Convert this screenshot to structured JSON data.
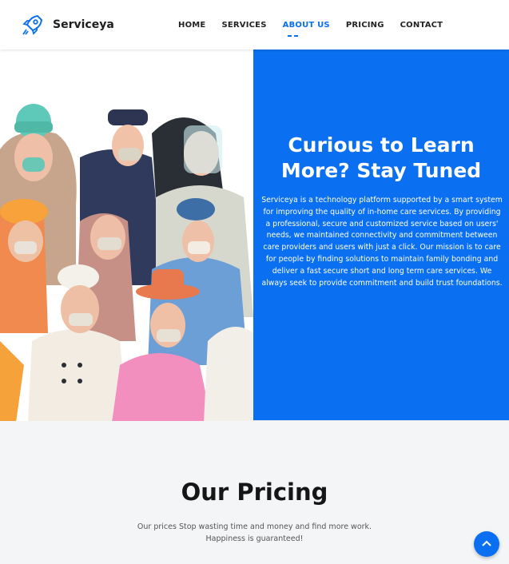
{
  "brand": {
    "name": "Serviceya",
    "logo_icon": "rocket-icon",
    "logo_color": "#0a6ff0"
  },
  "nav": {
    "items": [
      {
        "label": "HOME"
      },
      {
        "label": "SERVICES"
      },
      {
        "label": "ABOUT US",
        "active": true
      },
      {
        "label": "PRICING"
      },
      {
        "label": "CONTACT"
      }
    ]
  },
  "hero": {
    "title": "Curious to Learn More? Stay Tuned",
    "body": "Serviceya is a technology platform supported by a smart system for improving the quality of in-home care services. By providing a professional, secure and customized service based on users' needs, we maintained connectivity and commitment between care providers and users with just a click. Our mission is to care for people by finding solutions to maintain family bonding and deliver a fast secure short and long term care services. We always seek to provide commitment and build trust foundations.",
    "illustration": "masked-people-illustration",
    "accent_color": "#0a6ff0"
  },
  "pricing": {
    "title": "Our Pricing",
    "subtitle": "Our prices Stop wasting time and money and find more work. Happiness is guaranteed!"
  },
  "scroll_top": {
    "icon": "chevron-up-icon"
  }
}
